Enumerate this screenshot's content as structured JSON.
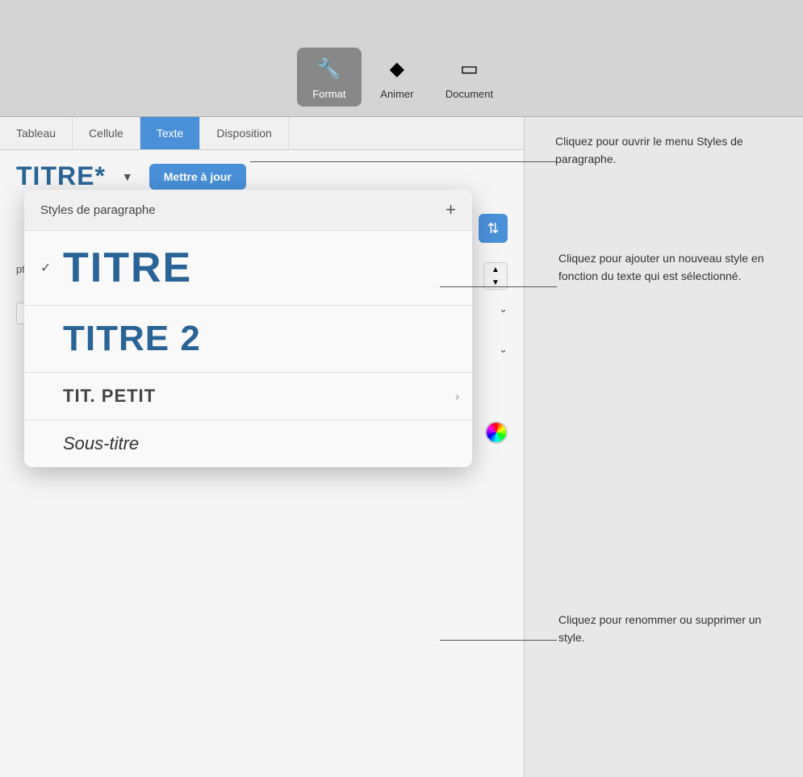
{
  "toolbar": {
    "buttons": [
      {
        "id": "format",
        "label": "Format",
        "icon": "🔧",
        "active": true
      },
      {
        "id": "animate",
        "label": "Animer",
        "icon": "◆",
        "active": false
      },
      {
        "id": "document",
        "label": "Document",
        "icon": "□",
        "active": false
      }
    ]
  },
  "sidebar": {
    "tabs": [
      {
        "id": "tableau",
        "label": "Tableau",
        "active": false
      },
      {
        "id": "cellule",
        "label": "Cellule",
        "active": false
      },
      {
        "id": "texte",
        "label": "Texte",
        "active": true
      },
      {
        "id": "disposition",
        "label": "Disposition",
        "active": false
      }
    ],
    "current_style": "TITRE*",
    "update_button": "Mettre à jour"
  },
  "styles_dropdown": {
    "title": "Styles de paragraphe",
    "add_tooltip": "+",
    "items": [
      {
        "id": "titre",
        "label": "TITRE",
        "selected": true
      },
      {
        "id": "titre2",
        "label": "TITRE 2",
        "selected": false
      },
      {
        "id": "titpetit",
        "label": "TIT. PETIT",
        "selected": false
      },
      {
        "id": "soustitre",
        "label": "Sous-titre",
        "selected": false
      }
    ]
  },
  "annotations": {
    "ann1": {
      "text": "Cliquez pour ouvrir\nle menu Styles de\nparagraphe."
    },
    "ann2": {
      "text": "Cliquez pour ajouter\nun nouveau style en\nfonction du texte qui\nest sélectionné."
    },
    "ann3": {
      "text": "Cliquez pour\nrenommer ou\nsupprimer un style."
    }
  }
}
